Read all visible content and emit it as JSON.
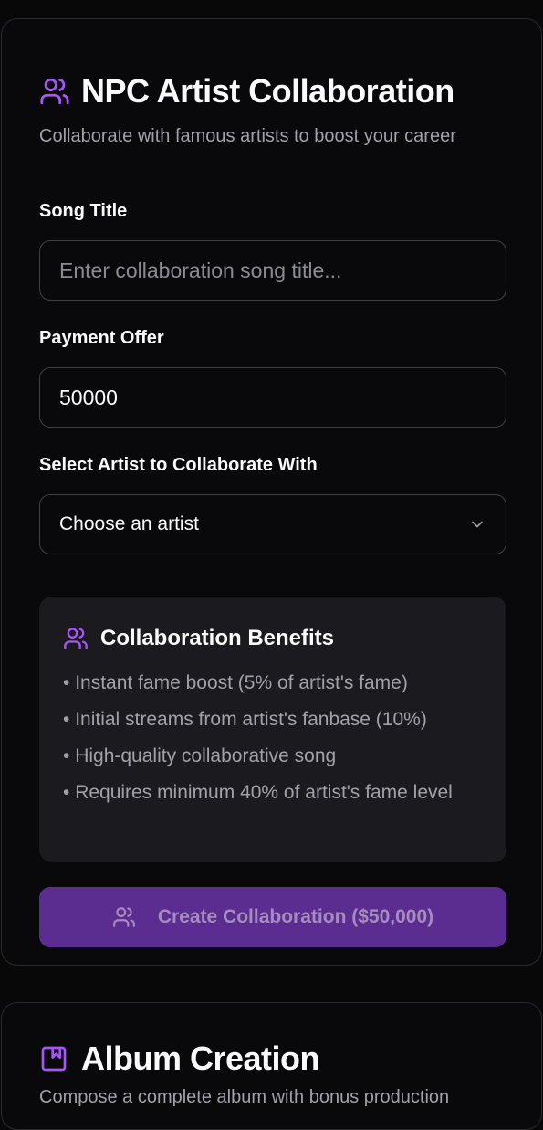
{
  "colors": {
    "accent": "#a855f7",
    "button_bg": "#5b2d91",
    "card_bg": "#09090b",
    "panel_bg": "#1b1b1f"
  },
  "collab": {
    "icon": "users-icon",
    "title": "NPC Artist Collaboration",
    "subtitle": "Collaborate with famous artists to boost your career",
    "song_title_label": "Song Title",
    "song_title_placeholder": "Enter collaboration song title...",
    "song_title_value": "",
    "payment_label": "Payment Offer",
    "payment_value": "50000",
    "artist_label": "Select Artist to Collaborate With",
    "artist_selected": "Choose an artist",
    "benefits": {
      "icon": "users-icon",
      "title": "Collaboration Benefits",
      "items": [
        "Instant fame boost (5% of artist's fame)",
        "Initial streams from artist's fanbase (10%)",
        "High-quality collaborative song",
        "Requires minimum 40% of artist's fame level"
      ]
    },
    "create_button": "Create Collaboration ($50,000)"
  },
  "album": {
    "icon": "album-icon",
    "title": "Album Creation",
    "subtitle": "Compose a complete album with bonus production"
  }
}
